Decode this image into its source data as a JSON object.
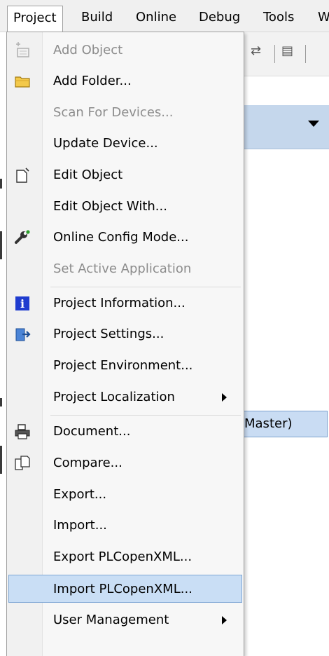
{
  "menubar": {
    "items": [
      {
        "label": "Project",
        "active": true
      },
      {
        "label": "Build"
      },
      {
        "label": "Online"
      },
      {
        "label": "Debug"
      },
      {
        "label": "Tools"
      },
      {
        "label": "W"
      }
    ]
  },
  "background": {
    "selected_tree_item": "Master)"
  },
  "menu": {
    "items": [
      {
        "label": "Add Object",
        "disabled": true,
        "icon": "add-object-icon"
      },
      {
        "label": "Add Folder...",
        "icon": "folder-icon"
      },
      {
        "label": "Scan For Devices...",
        "disabled": true
      },
      {
        "label": "Update Device..."
      },
      {
        "label": "Edit Object",
        "icon": "edit-object-icon"
      },
      {
        "label": "Edit Object With..."
      },
      {
        "label": "Online Config Mode...",
        "icon": "wrench-icon"
      },
      {
        "label": "Set Active Application",
        "disabled": true
      },
      {
        "label": "Project Information...",
        "icon": "info-icon"
      },
      {
        "label": "Project Settings...",
        "icon": "settings-icon"
      },
      {
        "label": "Project Environment..."
      },
      {
        "label": "Project Localization",
        "submenu": true
      },
      {
        "label": "Document...",
        "icon": "printer-icon"
      },
      {
        "label": "Compare...",
        "icon": "compare-icon"
      },
      {
        "label": "Export..."
      },
      {
        "label": "Import..."
      },
      {
        "label": "Export PLCopenXML..."
      },
      {
        "label": "Import PLCopenXML...",
        "highlighted": true
      },
      {
        "label": "User Management",
        "submenu": true
      }
    ]
  },
  "colors": {
    "highlight": "#c9def5",
    "highlight_border": "#7ea6d4",
    "disabled_text": "#8c8c8c",
    "info_blue": "#1f3ccf"
  }
}
